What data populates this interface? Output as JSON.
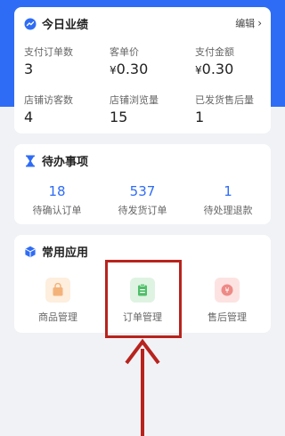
{
  "performance": {
    "title": "今日业绩",
    "edit_label": "编辑",
    "metrics": [
      {
        "label": "支付订单数",
        "value": "3",
        "currency": ""
      },
      {
        "label": "客单价",
        "value": "0.30",
        "currency": "¥"
      },
      {
        "label": "支付金额",
        "value": "0.30",
        "currency": "¥"
      },
      {
        "label": "店铺访客数",
        "value": "4",
        "currency": ""
      },
      {
        "label": "店铺浏览量",
        "value": "15",
        "currency": ""
      },
      {
        "label": "已发货售后量",
        "value": "1",
        "currency": ""
      }
    ]
  },
  "todo": {
    "title": "待办事项",
    "items": [
      {
        "value": "18",
        "label": "待确认订单"
      },
      {
        "value": "537",
        "label": "待发货订单"
      },
      {
        "value": "1",
        "label": "待处理退款"
      }
    ]
  },
  "apps": {
    "title": "常用应用",
    "items": [
      {
        "label": "商品管理",
        "icon": "shopping-bag-icon",
        "color": "#f3b27a"
      },
      {
        "label": "订单管理",
        "icon": "order-clipboard-icon",
        "color": "#4fbf6a"
      },
      {
        "label": "售后管理",
        "icon": "refund-icon",
        "color": "#ee8a86"
      }
    ]
  },
  "colors": {
    "primary": "#2f6cf6",
    "highlight": "#b8231d",
    "background": "#f1f2f6"
  }
}
